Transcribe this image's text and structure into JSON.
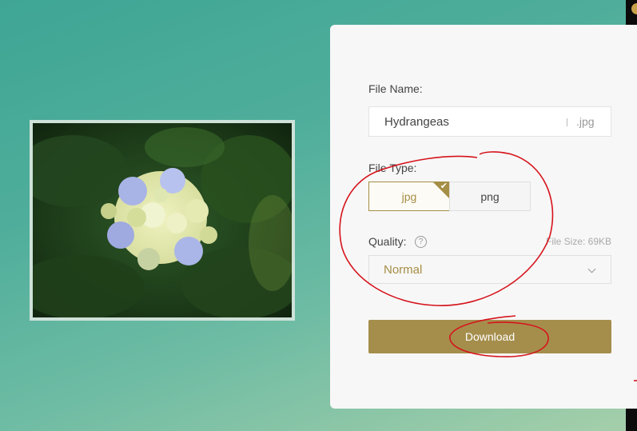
{
  "file_name": {
    "label": "File Name:",
    "value": "Hydrangeas",
    "extension": ".jpg"
  },
  "file_type": {
    "label": "File Type:",
    "options": [
      "jpg",
      "png"
    ],
    "selected": "jpg"
  },
  "quality": {
    "label": "Quality:",
    "help_icon": "question-circle-icon",
    "file_size": "File Size: 69KB",
    "selected": "Normal"
  },
  "download_label": "Download",
  "colors": {
    "accent": "#a58e4c",
    "annotation": "#d6141c"
  }
}
